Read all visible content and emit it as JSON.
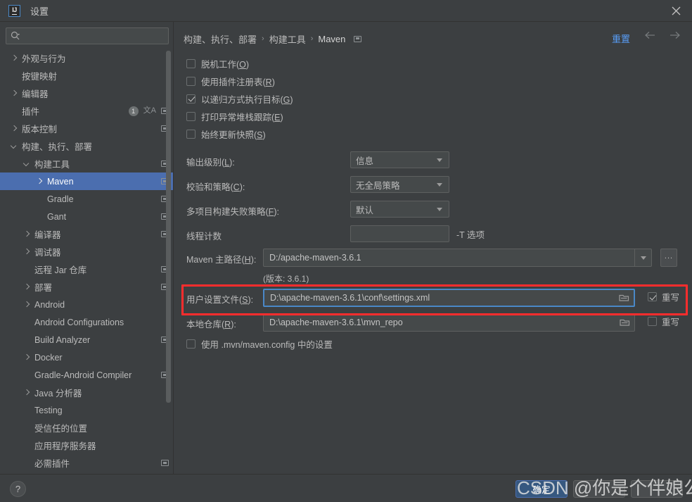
{
  "window": {
    "title": "设置",
    "logo_text": "IJ",
    "close_icon": "close-icon"
  },
  "search": {
    "value": "",
    "placeholder": ""
  },
  "sidebar": {
    "items": [
      {
        "label": "外观与行为",
        "indent": 0,
        "arrow": "right",
        "badges": []
      },
      {
        "label": "按键映射",
        "indent": 0,
        "arrow": "none",
        "badges": []
      },
      {
        "label": "编辑器",
        "indent": 0,
        "arrow": "right",
        "badges": []
      },
      {
        "label": "插件",
        "indent": 0,
        "arrow": "none",
        "badges": [
          "count:1",
          "translate",
          "copy"
        ]
      },
      {
        "label": "版本控制",
        "indent": 0,
        "arrow": "right",
        "badges": [
          "copy"
        ]
      },
      {
        "label": "构建、执行、部署",
        "indent": 0,
        "arrow": "down",
        "badges": []
      },
      {
        "label": "构建工具",
        "indent": 1,
        "arrow": "down",
        "badges": [
          "copy"
        ]
      },
      {
        "label": "Maven",
        "indent": 2,
        "arrow": "right",
        "badges": [
          "copy"
        ],
        "selected": true
      },
      {
        "label": "Gradle",
        "indent": 2,
        "arrow": "none",
        "badges": [
          "copy"
        ]
      },
      {
        "label": "Gant",
        "indent": 2,
        "arrow": "none",
        "badges": [
          "copy"
        ]
      },
      {
        "label": "编译器",
        "indent": 1,
        "arrow": "right",
        "badges": [
          "copy"
        ]
      },
      {
        "label": "调试器",
        "indent": 1,
        "arrow": "right",
        "badges": []
      },
      {
        "label": "远程 Jar 仓库",
        "indent": 1,
        "arrow": "none",
        "badges": [
          "copy"
        ]
      },
      {
        "label": "部署",
        "indent": 1,
        "arrow": "right",
        "badges": [
          "copy"
        ]
      },
      {
        "label": "Android",
        "indent": 1,
        "arrow": "right",
        "badges": []
      },
      {
        "label": "Android Configurations",
        "indent": 1,
        "arrow": "none",
        "badges": []
      },
      {
        "label": "Build Analyzer",
        "indent": 1,
        "arrow": "none",
        "badges": [
          "copy"
        ]
      },
      {
        "label": "Docker",
        "indent": 1,
        "arrow": "right",
        "badges": []
      },
      {
        "label": "Gradle-Android Compiler",
        "indent": 1,
        "arrow": "none",
        "badges": [
          "copy"
        ]
      },
      {
        "label": "Java 分析器",
        "indent": 1,
        "arrow": "right",
        "badges": []
      },
      {
        "label": "Testing",
        "indent": 1,
        "arrow": "none",
        "badges": []
      },
      {
        "label": "受信任的位置",
        "indent": 1,
        "arrow": "none",
        "badges": []
      },
      {
        "label": "应用程序服务器",
        "indent": 1,
        "arrow": "none",
        "badges": []
      },
      {
        "label": "必需插件",
        "indent": 1,
        "arrow": "none",
        "badges": [
          "copy"
        ]
      }
    ]
  },
  "breadcrumb": {
    "parts": [
      "构建、执行、部署",
      "构建工具"
    ],
    "current": "Maven",
    "separator": "›",
    "trailing_icon": "copy-icon"
  },
  "header": {
    "reset_label": "重置",
    "back_icon": "arrow-left-icon",
    "forward_icon": "arrow-right-icon"
  },
  "main": {
    "checkboxes": [
      {
        "label": "脱机工作(",
        "mnemonic": "O",
        "tail": ")",
        "checked": false
      },
      {
        "label": "使用插件注册表(",
        "mnemonic": "R",
        "tail": ")",
        "checked": false
      },
      {
        "label": "以递归方式执行目标(",
        "mnemonic": "G",
        "tail": ")",
        "checked": true
      },
      {
        "label": "打印异常堆栈跟踪(",
        "mnemonic": "E",
        "tail": ")",
        "checked": false
      },
      {
        "label": "始终更新快照(",
        "mnemonic": "S",
        "tail": ")",
        "checked": false
      }
    ],
    "output_level": {
      "label": "输出级别(",
      "mnemonic": "L",
      "tail": "):",
      "value": "信息"
    },
    "checksum_policy": {
      "label": "校验和策略(",
      "mnemonic": "C",
      "tail": "):",
      "value": "无全局策略"
    },
    "multiproject_fail_policy": {
      "label": "多项目构建失败策略(",
      "mnemonic": "F",
      "tail": "):",
      "value": "默认"
    },
    "thread_count": {
      "label": "线程计数",
      "value": "",
      "hint": "-T 选项"
    },
    "maven_home": {
      "label": "Maven 主路径(",
      "mnemonic": "H",
      "tail": "):",
      "value": "D:/apache-maven-3.6.1",
      "browse_label": "...",
      "version_note": "(版本: 3.6.1)"
    },
    "user_settings_file": {
      "label": "用户设置文件(",
      "mnemonic": "S",
      "tail": "):",
      "value": "D:\\apache-maven-3.6.1\\conf\\settings.xml",
      "override_label": "重写",
      "override_checked": true,
      "folder_icon": "folder-icon"
    },
    "local_repository": {
      "label": "本地仓库(",
      "mnemonic": "R",
      "tail": "):",
      "value": "D:\\apache-maven-3.6.1\\mvn_repo",
      "override_label": "重写",
      "override_checked": false,
      "folder_icon": "folder-icon"
    },
    "use_mvn_config": {
      "label": "使用 .mvn/maven.config 中的设置",
      "checked": false
    }
  },
  "footer": {
    "help_label": "?",
    "ok_label": "确定",
    "cancel_label": "",
    "apply_label": ""
  },
  "watermark": {
    "text": "CSDN @你是个伴娘公橙"
  },
  "colors": {
    "background": "#3c3f41",
    "selection": "#4b6eaf",
    "accent_link": "#589df6",
    "focus_border": "#4a88c7",
    "annotation": "#ff2d2d",
    "primary_button": "#365880"
  }
}
